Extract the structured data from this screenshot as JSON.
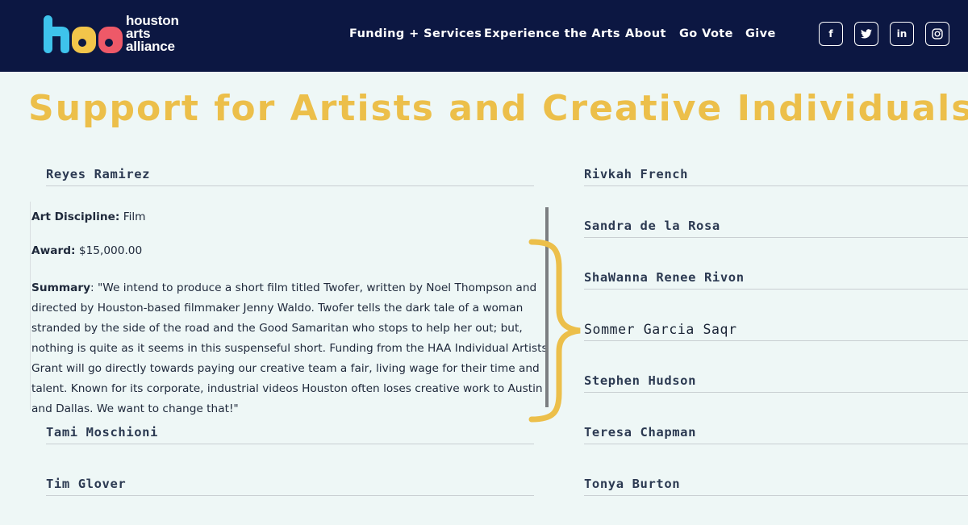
{
  "header": {
    "logo_lines": [
      "houston",
      "arts",
      "alliance"
    ],
    "nav": [
      "Funding + Services",
      "Experience the Arts",
      "About",
      "Go Vote",
      "Give"
    ],
    "social": [
      {
        "icon": "facebook-icon",
        "glyph": "f"
      },
      {
        "icon": "twitter-icon",
        "glyph": "🐦"
      },
      {
        "icon": "linkedin-icon",
        "glyph": "in"
      },
      {
        "icon": "instagram-icon",
        "glyph": "◎"
      }
    ]
  },
  "page": {
    "title": "Support for Artists and Creative Individuals"
  },
  "left_list": [
    "Reyes Ramirez",
    "Tami Moschioni",
    "Tim Glover"
  ],
  "right_list": [
    "Rivkah French",
    "Sandra de la Rosa",
    "ShaWanna Renee Rivon",
    "Sommer Garcia Saqr",
    "Stephen Hudson",
    "Teresa Chapman",
    "Tonya Burton"
  ],
  "detail": {
    "discipline_label": "Art Discipline:",
    "discipline_value": "Film",
    "award_label": "Award:",
    "award_value": "$15,000.00",
    "summary_label": "Summary",
    "summary_text": ": \"We intend to produce a short film titled Twofer, written by Noel Thompson and directed by Houston-based filmmaker Jenny Waldo. Twofer tells the dark tale of a woman stranded by the side of the road and the Good Samaritan who stops to help her out; but, nothing is quite as it seems in this suspenseful short. Funding from the HAA Individual Artists Grant will go directly towards paying our creative team a fair, living wage for their time and talent. Known for its corporate, industrial videos Houston often loses creative work to Austin and Dallas. We want to change that!\""
  },
  "colors": {
    "header_bg": "#0c1742",
    "title": "#ecbf4a",
    "brace": "#ecbf4a",
    "logo_blue": "#3ec3ec",
    "logo_yellow": "#f2c54a",
    "logo_pink": "#ee5968"
  }
}
